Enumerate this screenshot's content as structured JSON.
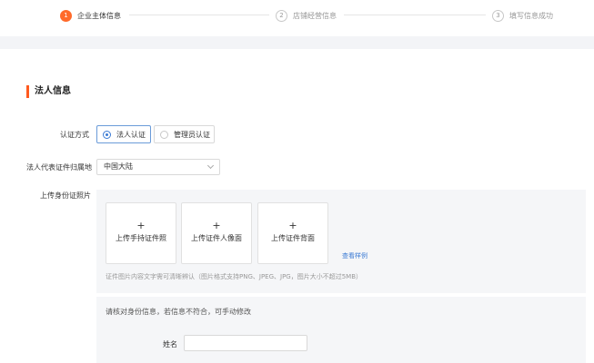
{
  "steps": [
    {
      "number": "1",
      "label": "企业主体信息",
      "active": true
    },
    {
      "number": "2",
      "label": "店铺经营信息",
      "active": false
    },
    {
      "number": "3",
      "label": "填写信息成功",
      "active": false
    }
  ],
  "section": {
    "title": "法人信息"
  },
  "form": {
    "auth_method_label": "认证方式",
    "auth_options": [
      "法人认证",
      "管理员认证"
    ],
    "auth_selected": "法人认证",
    "region_label": "法人代表证件归属地",
    "region_value": "中国大陆",
    "upload_label": "上传身份证照片",
    "upload_cards": [
      {
        "plus": "+",
        "label": "上传手持证件照"
      },
      {
        "plus": "+",
        "label": "上传证件人像面"
      },
      {
        "plus": "+",
        "label": "上传证件背面"
      }
    ],
    "sample_link": "查看样例",
    "upload_hint": "证件图片内容文字需可清晰辨认（图片格式支持PNG、JPEG、JPG，图片大小不超过5MB）",
    "verify_hint": "请核对身份信息，若信息不符合，可手动修改",
    "name_label": "姓名",
    "name_value": ""
  },
  "colors": {
    "accent": "#ff6a2a",
    "link": "#3b7bd4",
    "panel": "#f5f6f8"
  }
}
